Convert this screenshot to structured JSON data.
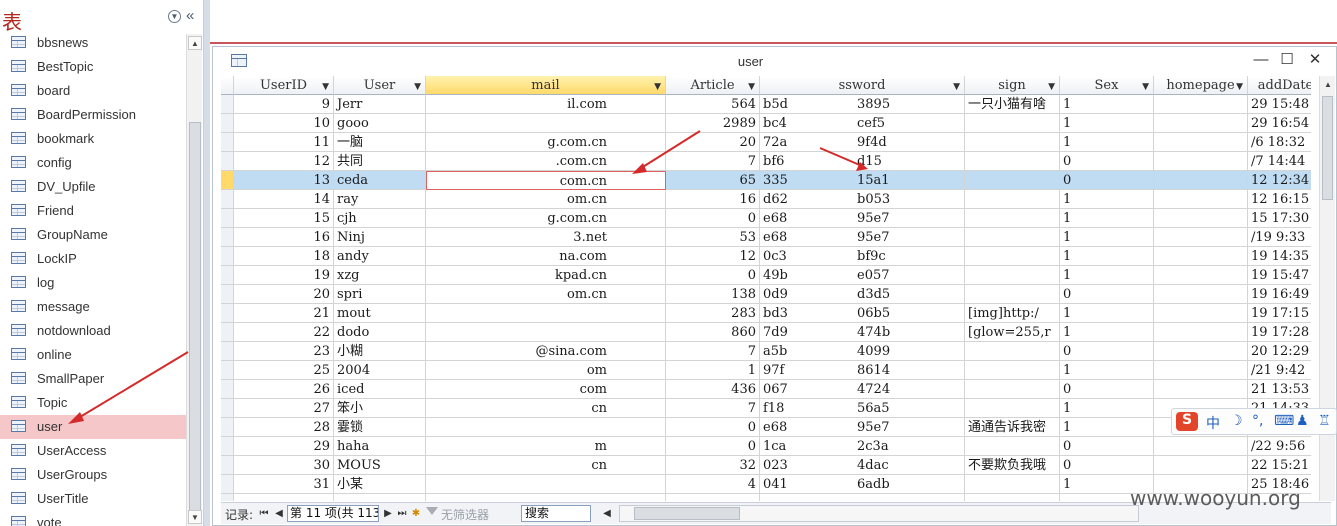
{
  "nav": {
    "title": "表",
    "dropdown_icon": "chevron-down-circle-icon",
    "collapse_icon": "double-chevron-left-icon",
    "items": [
      {
        "label": "bbsnews"
      },
      {
        "label": "BestTopic"
      },
      {
        "label": "board"
      },
      {
        "label": "BoardPermission"
      },
      {
        "label": "bookmark"
      },
      {
        "label": "config"
      },
      {
        "label": "DV_Upfile"
      },
      {
        "label": "Friend"
      },
      {
        "label": "GroupName"
      },
      {
        "label": "LockIP"
      },
      {
        "label": "log"
      },
      {
        "label": "message"
      },
      {
        "label": "notdownload"
      },
      {
        "label": "online"
      },
      {
        "label": "SmallPaper"
      },
      {
        "label": "Topic"
      },
      {
        "label": "user",
        "selected": true
      },
      {
        "label": "UserAccess"
      },
      {
        "label": "UserGroups"
      },
      {
        "label": "UserTitle"
      },
      {
        "label": "vote"
      }
    ]
  },
  "window": {
    "title": "user",
    "minimize_icon": "minimize-icon",
    "maximize_icon": "maximize-icon",
    "close_icon": "close-icon"
  },
  "grid": {
    "columns": [
      {
        "label": "UserID"
      },
      {
        "label": "User"
      },
      {
        "label": "mail"
      },
      {
        "label": "Article"
      },
      {
        "label": "ssword"
      },
      {
        "label": "sign"
      },
      {
        "label": "Sex"
      },
      {
        "label": "homepage"
      },
      {
        "label": "addDate"
      }
    ],
    "current_row": 4,
    "rows": [
      {
        "id": "9",
        "user": "Jerr",
        "email": "il.com",
        "article": "564",
        "pwd_a": "b5d",
        "pwd_b": "3895",
        "sign": "一只小猫有啥",
        "sex": "1",
        "homepage": "",
        "date": "29 15:48"
      },
      {
        "id": "10",
        "user": "gooo",
        "email": "",
        "article": "2989",
        "pwd_a": "bc4",
        "pwd_b": "cef5",
        "sign": "",
        "sex": "1",
        "homepage": "",
        "date": "29 16:54"
      },
      {
        "id": "11",
        "user": "一脑",
        "email": "g.com.cn",
        "article": "20",
        "pwd_a": "72a",
        "pwd_b": "9f4d",
        "sign": "",
        "sex": "1",
        "homepage": "",
        "date": "/6 18:32"
      },
      {
        "id": "12",
        "user": "共同",
        "email": ".com.cn",
        "article": "7",
        "pwd_a": "bf6",
        "pwd_b": "d15",
        "sign": "",
        "sex": "0",
        "homepage": "",
        "date": "/7 14:44"
      },
      {
        "id": "13",
        "user": "ceda",
        "email": "com.cn",
        "article": "65",
        "pwd_a": "335",
        "pwd_b": "15a1",
        "sign": "",
        "sex": "0",
        "homepage": "",
        "date": "12 12:34"
      },
      {
        "id": "14",
        "user": "ray",
        "email": "om.cn",
        "article": "16",
        "pwd_a": "d62",
        "pwd_b": "b053",
        "sign": "",
        "sex": "1",
        "homepage": "",
        "date": "12 16:15"
      },
      {
        "id": "15",
        "user": "cjh",
        "email": "g.com.cn",
        "article": "0",
        "pwd_a": "e68",
        "pwd_b": "95e7",
        "sign": "",
        "sex": "1",
        "homepage": "",
        "date": "15 17:30"
      },
      {
        "id": "16",
        "user": "Ninj",
        "email": "3.net",
        "article": "53",
        "pwd_a": "e68",
        "pwd_b": "95e7",
        "sign": "",
        "sex": "1",
        "homepage": "",
        "date": "/19 9:33"
      },
      {
        "id": "18",
        "user": "andy",
        "email": "na.com",
        "article": "12",
        "pwd_a": "0c3",
        "pwd_b": "bf9c",
        "sign": "",
        "sex": "1",
        "homepage": "",
        "date": "19 14:35"
      },
      {
        "id": "19",
        "user": "xzg",
        "email": "kpad.cn",
        "article": "0",
        "pwd_a": "49b",
        "pwd_b": "e057",
        "sign": "",
        "sex": "1",
        "homepage": "",
        "date": "19 15:47"
      },
      {
        "id": "20",
        "user": "spri",
        "email": "om.cn",
        "article": "138",
        "pwd_a": "0d9",
        "pwd_b": "d3d5",
        "sign": "",
        "sex": "0",
        "homepage": "",
        "date": "19 16:49"
      },
      {
        "id": "21",
        "user": "mout",
        "email": "",
        "article": "283",
        "pwd_a": "bd3",
        "pwd_b": "06b5",
        "sign": "[img]http:/",
        "sex": "1",
        "homepage": "",
        "date": "19 17:15"
      },
      {
        "id": "22",
        "user": "dodo",
        "email": "",
        "article": "860",
        "pwd_a": "7d9",
        "pwd_b": "474b",
        "sign": "[glow=255,r",
        "sex": "1",
        "homepage": "",
        "date": "19 17:28"
      },
      {
        "id": "23",
        "user": "小糊",
        "email": "@sina.com",
        "article": "7",
        "pwd_a": "a5b",
        "pwd_b": "4099",
        "sign": "",
        "sex": "0",
        "homepage": "",
        "date": "20 12:29"
      },
      {
        "id": "25",
        "user": "2004",
        "email": "om",
        "article": "1",
        "pwd_a": "97f",
        "pwd_b": "8614",
        "sign": "",
        "sex": "1",
        "homepage": "",
        "date": "/21 9:42"
      },
      {
        "id": "26",
        "user": "iced",
        "email": "com",
        "article": "436",
        "pwd_a": "067",
        "pwd_b": "4724",
        "sign": "",
        "sex": "0",
        "homepage": "",
        "date": "21 13:53"
      },
      {
        "id": "27",
        "user": "笨小",
        "email": "cn",
        "article": "7",
        "pwd_a": "f18",
        "pwd_b": "56a5",
        "sign": "",
        "sex": "1",
        "homepage": "",
        "date": "21 14:33"
      },
      {
        "id": "28",
        "user": "霎锁",
        "email": "",
        "article": "0",
        "pwd_a": "e68",
        "pwd_b": "95e7",
        "sign": "通通告诉我密",
        "sex": "1",
        "homepage": "",
        "date": ""
      },
      {
        "id": "29",
        "user": "haha",
        "email": "m",
        "article": "0",
        "pwd_a": "1ca",
        "pwd_b": "2c3a",
        "sign": "",
        "sex": "0",
        "homepage": "",
        "date": "/22 9:56"
      },
      {
        "id": "30",
        "user": "MOUS",
        "email": "cn",
        "article": "32",
        "pwd_a": "023",
        "pwd_b": "4dac",
        "sign": "不要欺负我哦",
        "sex": "0",
        "homepage": "",
        "date": "22 15:21"
      },
      {
        "id": "31",
        "user": "小某",
        "email": "",
        "article": "4",
        "pwd_a": "041",
        "pwd_b": "6adb",
        "sign": "",
        "sex": "1",
        "homepage": "",
        "date": "25 18:46"
      },
      {
        "id": "",
        "user": "",
        "email": "",
        "article": "",
        "pwd_a": "",
        "pwd_b": "",
        "sign": "",
        "sex": "",
        "homepage": "",
        "date": ""
      }
    ]
  },
  "navbar": {
    "record_label": "记录:",
    "first_icon": "first-record-icon",
    "prev_icon": "prev-record-icon",
    "next_icon": "next-record-icon",
    "last_icon": "last-record-icon",
    "new_icon": "new-record-icon",
    "record_value": "第 11 项(共 113",
    "filter_label": "无筛选器",
    "search_value": "搜索"
  },
  "ime": {
    "logo": "S",
    "mode": "中"
  },
  "watermark": "www.wooyun.org",
  "colors": {
    "selected_nav": "#f6c7c9",
    "current_row": "#bfdcf3",
    "highlight_header": "#ffd96a",
    "arrow": "#d42a2a"
  }
}
